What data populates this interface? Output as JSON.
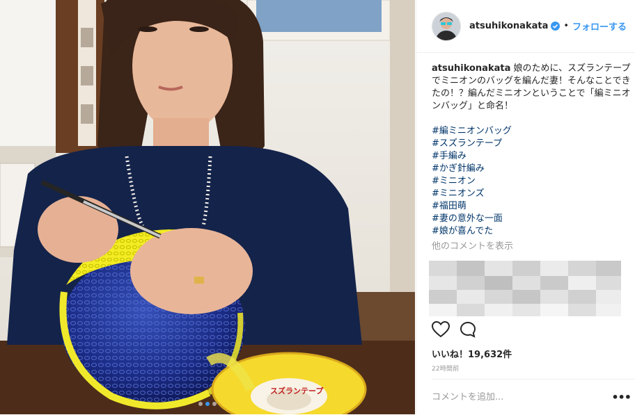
{
  "header": {
    "username": "atsuhikonakata",
    "separator": "•",
    "follow_label": "フォローする",
    "avatar_icon": "avatar-image",
    "verified_icon": "verified-badge-icon"
  },
  "caption": {
    "username": "atsuhikonakata",
    "text": "娘のために、スズランテープでミニオンのバッグを編んだ妻！そんなことできたの！？編んだミニオンということで「編ミニオンバッグ」と命名！",
    "hashtags": [
      "#編ミニオンバッグ",
      "#スズランテープ",
      "#手編み",
      "#かぎ針編み",
      "#ミニオン",
      "#ミニオンズ",
      "#福田萌",
      "#妻の意外な一面",
      "#娘が喜んでた"
    ]
  },
  "view_comments_label": "他のコメントを表示",
  "actions": {
    "like_icon": "heart-icon",
    "comment_icon": "comment-icon"
  },
  "likes_text": "いいね！19,632件",
  "timestamp": "22時間前",
  "comment_input": {
    "placeholder": "コメントを追加..."
  },
  "options_label": "•••",
  "photo": {
    "tape_label": "スズランテープ",
    "carousel": {
      "count": 3,
      "active_index": 1
    }
  },
  "colors": {
    "accent": "#3897f0",
    "hashtag": "#003569",
    "text": "#262626",
    "muted": "#999999"
  }
}
